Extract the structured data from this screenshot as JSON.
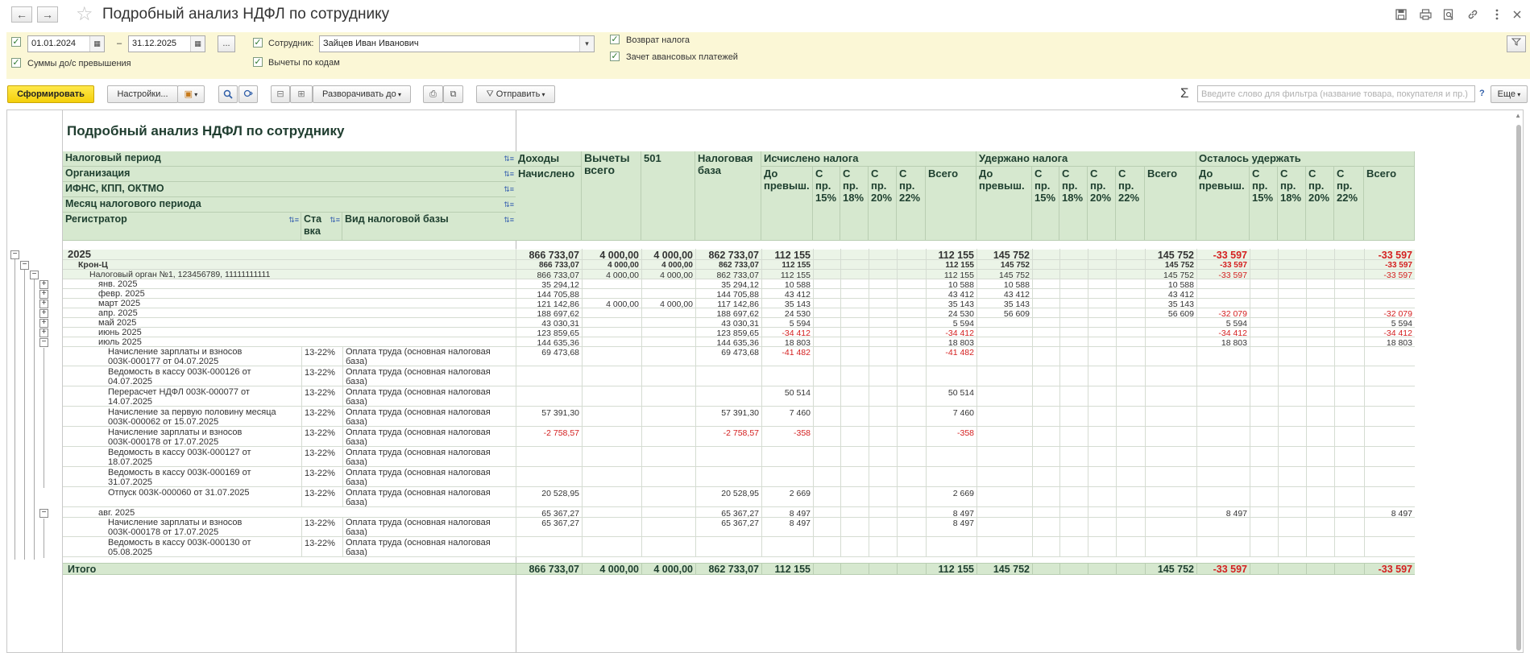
{
  "window": {
    "title": "Подробный анализ НДФЛ по сотруднику",
    "back": "←",
    "forward": "→",
    "favorite": "☆"
  },
  "titlebar_icons": [
    "save-icon",
    "print-icon",
    "preview-icon",
    "link-icon",
    "more-icon",
    "close-icon"
  ],
  "filters": {
    "date_from": "01.01.2024",
    "date_dash": "–",
    "date_to": "31.12.2025",
    "period_btn": "...",
    "employee_label": "Сотрудник:",
    "employee_value": "Зайцев Иван Иванович",
    "sums_label": "Суммы до/с превышения",
    "deductions_label": "Вычеты по кодам",
    "refund_label": "Возврат налога",
    "advance_label": "Зачет авансовых платежей"
  },
  "toolbar": {
    "generate": "Сформировать",
    "settings": "Настройки...",
    "expand": "Разворачивать до",
    "send": "Отправить",
    "sigma": "Σ",
    "search_placeholder": "Введите слово для фильтра (название товара, покупателя и пр.)",
    "help": "?",
    "more": "Еще"
  },
  "report": {
    "title": "Подробный анализ НДФЛ по сотруднику",
    "row_headers": {
      "period": "Налоговый период",
      "org": "Организация",
      "ifns": "ИФНС, КПП, ОКТМО",
      "month": "Месяц налогового периода",
      "registrar": "Регистратор",
      "rate": "Ставка",
      "base_kind": "Вид налоговой базы"
    },
    "col_headers": {
      "income": "Доходы",
      "accrued": "Начислено",
      "deductions_total": "Вычеты всего",
      "code501": "501",
      "tax_base": "Налоговая база",
      "calculated": "Исчислено налога",
      "withheld": "Удержано налога",
      "remaining": "Осталось удержать",
      "before_excess": "До превыш.",
      "w15": "С пр. 15%",
      "w18": "С пр. 18%",
      "w20": "С пр. 20%",
      "w22": "С пр. 22%",
      "total": "Всего"
    },
    "rows": [
      {
        "label": "2025",
        "level": 0,
        "tree": "−",
        "style": "year",
        "v": [
          "866 733,07",
          "4 000,00",
          "4 000,00",
          "862 733,07",
          "112 155",
          "",
          "",
          "",
          "",
          "112 155",
          "145 752",
          "",
          "",
          "",
          "",
          "145 752",
          "-33 597",
          "",
          "",
          "",
          "",
          "-33 597"
        ]
      },
      {
        "label": "Крон-Ц",
        "level": 1,
        "tree": "−",
        "style": "org",
        "v": [
          "866 733,07",
          "4 000,00",
          "4 000,00",
          "862 733,07",
          "112 155",
          "",
          "",
          "",
          "",
          "112 155",
          "145 752",
          "",
          "",
          "",
          "",
          "145 752",
          "-33 597",
          "",
          "",
          "",
          "",
          "-33 597"
        ]
      },
      {
        "label": "Налоговый орган №1, 123456789, 11111111111",
        "level": 2,
        "tree": "−",
        "style": "ifns",
        "v": [
          "866 733,07",
          "4 000,00",
          "4 000,00",
          "862 733,07",
          "112 155",
          "",
          "",
          "",
          "",
          "112 155",
          "145 752",
          "",
          "",
          "",
          "",
          "145 752",
          "-33 597",
          "",
          "",
          "",
          "",
          "-33 597"
        ]
      },
      {
        "label": "янв. 2025",
        "level": 3,
        "tree": "+",
        "style": "month",
        "v": [
          "35 294,12",
          "",
          "",
          "35 294,12",
          "10 588",
          "",
          "",
          "",
          "",
          "10 588",
          "10 588",
          "",
          "",
          "",
          "",
          "10 588",
          "",
          "",
          "",
          "",
          "",
          ""
        ]
      },
      {
        "label": "февр. 2025",
        "level": 3,
        "tree": "+",
        "style": "month",
        "v": [
          "144 705,88",
          "",
          "",
          "144 705,88",
          "43 412",
          "",
          "",
          "",
          "",
          "43 412",
          "43 412",
          "",
          "",
          "",
          "",
          "43 412",
          "",
          "",
          "",
          "",
          "",
          ""
        ]
      },
      {
        "label": "март 2025",
        "level": 3,
        "tree": "+",
        "style": "month",
        "v": [
          "121 142,86",
          "4 000,00",
          "4 000,00",
          "117 142,86",
          "35 143",
          "",
          "",
          "",
          "",
          "35 143",
          "35 143",
          "",
          "",
          "",
          "",
          "35 143",
          "",
          "",
          "",
          "",
          "",
          ""
        ]
      },
      {
        "label": "апр. 2025",
        "level": 3,
        "tree": "+",
        "style": "month",
        "v": [
          "188 697,62",
          "",
          "",
          "188 697,62",
          "24 530",
          "",
          "",
          "",
          "",
          "24 530",
          "56 609",
          "",
          "",
          "",
          "",
          "56 609",
          "-32 079",
          "",
          "",
          "",
          "",
          "-32 079"
        ]
      },
      {
        "label": "май 2025",
        "level": 3,
        "tree": "+",
        "style": "month",
        "v": [
          "43 030,31",
          "",
          "",
          "43 030,31",
          "5 594",
          "",
          "",
          "",
          "",
          "5 594",
          "",
          "",
          "",
          "",
          "",
          "",
          "5 594",
          "",
          "",
          "",
          "",
          "5 594"
        ]
      },
      {
        "label": "июнь 2025",
        "level": 3,
        "tree": "+",
        "style": "month",
        "v": [
          "123 859,65",
          "",
          "",
          "123 859,65",
          "-34 412",
          "",
          "",
          "",
          "",
          "-34 412",
          "",
          "",
          "",
          "",
          "",
          "",
          "-34 412",
          "",
          "",
          "",
          "",
          "-34 412"
        ]
      },
      {
        "label": "июль 2025",
        "level": 3,
        "tree": "−",
        "style": "month",
        "v": [
          "144 635,36",
          "",
          "",
          "144 635,36",
          "18 803",
          "",
          "",
          "",
          "",
          "18 803",
          "",
          "",
          "",
          "",
          "",
          "",
          "18 803",
          "",
          "",
          "",
          "",
          "18 803"
        ]
      },
      {
        "label": "Начисление зарплаты и взносов\n003К-000177 от 04.07.2025",
        "level": 4,
        "style": "doc",
        "rate": "13-22%",
        "base": "Оплата труда (основная налоговая\nбаза)",
        "v": [
          "69 473,68",
          "",
          "",
          "69 473,68",
          "-41 482",
          "",
          "",
          "",
          "",
          "-41 482",
          "",
          "",
          "",
          "",
          "",
          "",
          "",
          "",
          "",
          "",
          "",
          ""
        ]
      },
      {
        "label": "Ведомость в кассу 003К-000126 от\n04.07.2025",
        "level": 4,
        "style": "doc",
        "rate": "13-22%",
        "base": "Оплата труда (основная налоговая\nбаза)",
        "v": [
          "",
          "",
          "",
          "",
          "",
          "",
          "",
          "",
          "",
          "",
          "",
          "",
          "",
          "",
          "",
          "",
          "",
          "",
          "",
          "",
          "",
          ""
        ]
      },
      {
        "label": "Перерасчет НДФЛ 003К-000077 от\n14.07.2025",
        "level": 4,
        "style": "doc",
        "rate": "13-22%",
        "base": "Оплата труда (основная налоговая\nбаза)",
        "v": [
          "",
          "",
          "",
          "",
          "50 514",
          "",
          "",
          "",
          "",
          "50 514",
          "",
          "",
          "",
          "",
          "",
          "",
          "",
          "",
          "",
          "",
          "",
          ""
        ]
      },
      {
        "label": "Начисление за первую половину месяца\n003К-000062 от 15.07.2025",
        "level": 4,
        "style": "doc",
        "rate": "13-22%",
        "base": "Оплата труда (основная налоговая\nбаза)",
        "v": [
          "57 391,30",
          "",
          "",
          "57 391,30",
          "7 460",
          "",
          "",
          "",
          "",
          "7 460",
          "",
          "",
          "",
          "",
          "",
          "",
          "",
          "",
          "",
          "",
          "",
          ""
        ]
      },
      {
        "label": "Начисление зарплаты и взносов\n003К-000178 от 17.07.2025",
        "level": 4,
        "style": "doc",
        "rate": "13-22%",
        "base": "Оплата труда (основная налоговая\nбаза)",
        "v": [
          "-2 758,57",
          "",
          "",
          "-2 758,57",
          "-358",
          "",
          "",
          "",
          "",
          "-358",
          "",
          "",
          "",
          "",
          "",
          "",
          "",
          "",
          "",
          "",
          "",
          ""
        ]
      },
      {
        "label": "Ведомость в кассу 003К-000127 от\n18.07.2025",
        "level": 4,
        "style": "doc",
        "rate": "13-22%",
        "base": "Оплата труда (основная налоговая\nбаза)",
        "v": [
          "",
          "",
          "",
          "",
          "",
          "",
          "",
          "",
          "",
          "",
          "",
          "",
          "",
          "",
          "",
          "",
          "",
          "",
          "",
          "",
          "",
          ""
        ]
      },
      {
        "label": "Ведомость в кассу 003К-000169 от\n31.07.2025",
        "level": 4,
        "style": "doc",
        "rate": "13-22%",
        "base": "Оплата труда (основная налоговая\nбаза)",
        "v": [
          "",
          "",
          "",
          "",
          "",
          "",
          "",
          "",
          "",
          "",
          "",
          "",
          "",
          "",
          "",
          "",
          "",
          "",
          "",
          "",
          "",
          ""
        ]
      },
      {
        "label": "Отпуск 003К-000060 от 31.07.2025",
        "level": 4,
        "style": "doc",
        "rate": "13-22%",
        "base": "Оплата труда (основная налоговая\nбаза)",
        "v": [
          "20 528,95",
          "",
          "",
          "20 528,95",
          "2 669",
          "",
          "",
          "",
          "",
          "2 669",
          "",
          "",
          "",
          "",
          "",
          "",
          "",
          "",
          "",
          "",
          "",
          ""
        ]
      },
      {
        "label": "авг. 2025",
        "level": 3,
        "tree": "−",
        "style": "month",
        "v": [
          "65 367,27",
          "",
          "",
          "65 367,27",
          "8 497",
          "",
          "",
          "",
          "",
          "8 497",
          "",
          "",
          "",
          "",
          "",
          "",
          "8 497",
          "",
          "",
          "",
          "",
          "8 497"
        ]
      },
      {
        "label": "Начисление зарплаты и взносов\n003К-000178 от 17.07.2025",
        "level": 4,
        "style": "doc",
        "rate": "13-22%",
        "base": "Оплата труда (основная налоговая\nбаза)",
        "v": [
          "65 367,27",
          "",
          "",
          "65 367,27",
          "8 497",
          "",
          "",
          "",
          "",
          "8 497",
          "",
          "",
          "",
          "",
          "",
          "",
          "",
          "",
          "",
          "",
          "",
          ""
        ]
      },
      {
        "label": "Ведомость в кассу 003К-000130 от\n05.08.2025",
        "level": 4,
        "style": "doc",
        "rate": "13-22%",
        "base": "Оплата труда (основная налоговая\nбаза)",
        "v": [
          "",
          "",
          "",
          "",
          "",
          "",
          "",
          "",
          "",
          "",
          "",
          "",
          "",
          "",
          "",
          "",
          "",
          "",
          "",
          "",
          "",
          ""
        ]
      }
    ],
    "total": {
      "label": "Итого",
      "v": [
        "866 733,07",
        "4 000,00",
        "4 000,00",
        "862 733,07",
        "112 155",
        "",
        "",
        "",
        "",
        "112 155",
        "145 752",
        "",
        "",
        "",
        "",
        "145 752",
        "-33 597",
        "",
        "",
        "",
        "",
        "-33 597"
      ]
    }
  },
  "colors": {
    "header_bg": "#d6e8cf",
    "row_bg": "#ebf4e7",
    "filter_bg": "#fbf7d6",
    "negative": "#d42020",
    "primary_button": "#f4cf0b"
  }
}
